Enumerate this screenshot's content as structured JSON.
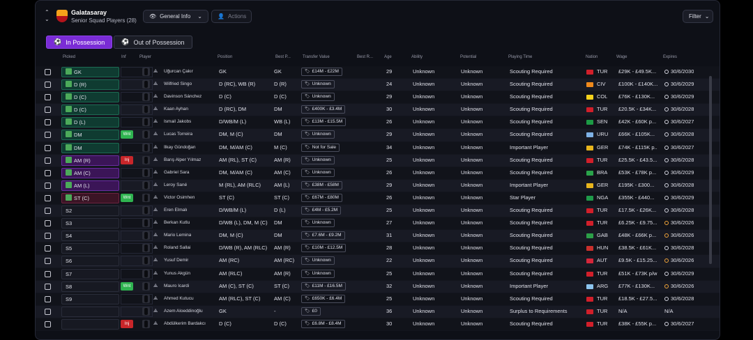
{
  "header": {
    "club_name": "Galatasaray",
    "subtitle": "Senior Squad Players (28)",
    "view_dropdown": "General Info",
    "actions_label": "Actions",
    "filter_label": "Filter"
  },
  "tabs": [
    "In Possession",
    "Out of Possession"
  ],
  "columns": [
    "Picked",
    "Inf",
    "Player",
    "Position",
    "Best P...",
    "Transfer Value",
    "Best R...",
    "Age",
    "Ability",
    "Potential",
    "Playing Time",
    "Nation",
    "Wage",
    "Expires"
  ],
  "colors": {
    "accent": "#7a2cd6",
    "wanted": "#2fb350",
    "injured": "#c8262a",
    "picked_green": "#0f3b31",
    "picked_purple": "#3b1557"
  },
  "rows": [
    {
      "pick": "GK",
      "pk": "g",
      "inf": "",
      "name": "Uğurcan Çakır",
      "position": "GK",
      "best": "GK",
      "value": "£14M - £22M",
      "age": "29",
      "ability": "Unknown",
      "potential": "Unknown",
      "playing": "Scouting Required",
      "nation": "TUR",
      "flag": "#d11f2a",
      "wage": "£29K - £49.5K...",
      "clock": "white",
      "expires": "30/6/2030"
    },
    {
      "pick": "D (R)",
      "pk": "g",
      "inf": "",
      "name": "Wilfried Singo",
      "position": "D (RC), WB (R)",
      "best": "D (R)",
      "value": "Unknown",
      "age": "24",
      "ability": "Unknown",
      "potential": "Unknown",
      "playing": "Scouting Required",
      "nation": "CIV",
      "flag": "#f08a1c",
      "wage": "£100K - £140K...",
      "clock": "white",
      "expires": "30/6/2029"
    },
    {
      "pick": "D (C)",
      "pk": "g",
      "inf": "",
      "name": "Davinson Sánchez",
      "position": "D (C)",
      "best": "D (C)",
      "value": "Unknown",
      "age": "29",
      "ability": "Unknown",
      "potential": "Unknown",
      "playing": "Scouting Required",
      "nation": "COL",
      "flag": "#f5d21c",
      "wage": "£76K - £130K...",
      "clock": "white",
      "expires": "30/6/2029"
    },
    {
      "pick": "D (C)",
      "pk": "g",
      "inf": "",
      "name": "Kaan Ayhan",
      "position": "D (RC), DM",
      "best": "DM",
      "value": "£400K - £3.4M",
      "age": "30",
      "ability": "Unknown",
      "potential": "Unknown",
      "playing": "Scouting Required",
      "nation": "TUR",
      "flag": "#d11f2a",
      "wage": "£20.5K - £34K...",
      "clock": "white",
      "expires": "30/6/2028"
    },
    {
      "pick": "D (L)",
      "pk": "g",
      "inf": "",
      "name": "Ismail Jakobs",
      "position": "D/WB/M (L)",
      "best": "WB (L)",
      "value": "£13M - £15.5M",
      "age": "26",
      "ability": "Unknown",
      "potential": "Unknown",
      "playing": "Scouting Required",
      "nation": "SEN",
      "flag": "#1c9a44",
      "wage": "£42K - £60K p...",
      "clock": "white",
      "expires": "30/6/2027"
    },
    {
      "pick": "DM",
      "pk": "g",
      "inf": "Wnt",
      "name": "Lucas Torreira",
      "position": "DM, M (C)",
      "best": "DM",
      "value": "Unknown",
      "age": "29",
      "ability": "Unknown",
      "potential": "Unknown",
      "playing": "Scouting Required",
      "nation": "URU",
      "flag": "#7fb2e6",
      "wage": "£66K - £105K...",
      "clock": "white",
      "expires": "30/6/2028"
    },
    {
      "pick": "DM",
      "pk": "g",
      "inf": "",
      "name": "İlkay Gündoğan",
      "position": "DM, M/AM (C)",
      "best": "M (C)",
      "value": "Not for Sale",
      "age": "34",
      "ability": "Unknown",
      "potential": "Unknown",
      "playing": "Important Player",
      "nation": "GER",
      "flag": "#e8b51d",
      "wage": "£74K - £115K p...",
      "clock": "white",
      "expires": "30/6/2027"
    },
    {
      "pick": "AM (R)",
      "pk": "p",
      "inf": "Inj",
      "name": "Barış Alper Yılmaz",
      "position": "AM (RL), ST (C)",
      "best": "AM (R)",
      "value": "Unknown",
      "age": "25",
      "ability": "Unknown",
      "potential": "Unknown",
      "playing": "Scouting Required",
      "nation": "TUR",
      "flag": "#d11f2a",
      "wage": "£25.5K - £43.5...",
      "clock": "white",
      "expires": "30/6/2028"
    },
    {
      "pick": "AM (C)",
      "pk": "p",
      "inf": "",
      "name": "Gabriel Sara",
      "position": "DM, M/AM (C)",
      "best": "AM (C)",
      "value": "Unknown",
      "age": "26",
      "ability": "Unknown",
      "potential": "Unknown",
      "playing": "Scouting Required",
      "nation": "BRA",
      "flag": "#2aa34a",
      "wage": "£53K - £78K p...",
      "clock": "white",
      "expires": "30/6/2029"
    },
    {
      "pick": "AM (L)",
      "pk": "p",
      "inf": "",
      "name": "Leroy Sané",
      "position": "M (RL), AM (RLC)",
      "best": "AM (L)",
      "value": "£38M - £58M",
      "age": "29",
      "ability": "Unknown",
      "potential": "Unknown",
      "playing": "Important Player",
      "nation": "GER",
      "flag": "#e8b51d",
      "wage": "£195K - £300...",
      "clock": "white",
      "expires": "30/6/2028"
    },
    {
      "pick": "ST (C)",
      "pk": "r",
      "inf": "Wnt",
      "name": "Victor Osimhen",
      "position": "ST (C)",
      "best": "ST (C)",
      "value": "£67M - £80M",
      "age": "26",
      "ability": "Unknown",
      "potential": "Unknown",
      "playing": "Star Player",
      "nation": "NGA",
      "flag": "#1f9a4a",
      "wage": "£355K - £440...",
      "clock": "white",
      "expires": "30/6/2029"
    },
    {
      "pick": "S2",
      "pk": "",
      "inf": "",
      "name": "Eren Elmalı",
      "position": "D/WB/M (L)",
      "best": "D (L)",
      "value": "£4M - £5.2M",
      "age": "25",
      "ability": "Unknown",
      "potential": "Unknown",
      "playing": "Scouting Required",
      "nation": "TUR",
      "flag": "#d11f2a",
      "wage": "£17.5K - £26K...",
      "clock": "white",
      "expires": "30/6/2028"
    },
    {
      "pick": "S3",
      "pk": "",
      "inf": "",
      "name": "Berkan Kutlu",
      "position": "D/WB (L), DM, M (C)",
      "best": "DM",
      "value": "Unknown",
      "age": "27",
      "ability": "Unknown",
      "potential": "Unknown",
      "playing": "Scouting Required",
      "nation": "TUR",
      "flag": "#d11f2a",
      "wage": "£6.25K - £9.75...",
      "clock": "amber",
      "expires": "30/6/2026"
    },
    {
      "pick": "S4",
      "pk": "",
      "inf": "",
      "name": "Mario Lemina",
      "position": "DM, M (C)",
      "best": "DM",
      "value": "£7.6M - £9.2M",
      "age": "31",
      "ability": "Unknown",
      "potential": "Unknown",
      "playing": "Scouting Required",
      "nation": "GAB",
      "flag": "#2c9f48",
      "wage": "£48K - £66K p...",
      "clock": "amber",
      "expires": "30/6/2026"
    },
    {
      "pick": "S5",
      "pk": "",
      "inf": "",
      "name": "Roland Sallai",
      "position": "D/WB (R), AM (RLC)",
      "best": "AM (R)",
      "value": "£10M - £12.5M",
      "age": "28",
      "ability": "Unknown",
      "potential": "Unknown",
      "playing": "Scouting Required",
      "nation": "HUN",
      "flag": "#c9302c",
      "wage": "£38.5K - £61K...",
      "clock": "white",
      "expires": "30/6/2028"
    },
    {
      "pick": "S6",
      "pk": "",
      "inf": "",
      "name": "Yusuf Demir",
      "position": "AM (RC)",
      "best": "AM (RC)",
      "value": "Unknown",
      "age": "22",
      "ability": "Unknown",
      "potential": "Unknown",
      "playing": "Scouting Required",
      "nation": "AUT",
      "flag": "#d6263a",
      "wage": "£9.5K - £15.25...",
      "clock": "amber",
      "expires": "30/6/2026"
    },
    {
      "pick": "S7",
      "pk": "",
      "inf": "",
      "name": "Yunus Akgün",
      "position": "AM (RLC)",
      "best": "AM (R)",
      "value": "Unknown",
      "age": "25",
      "ability": "Unknown",
      "potential": "Unknown",
      "playing": "Scouting Required",
      "nation": "TUR",
      "flag": "#d11f2a",
      "wage": "£51K - £73K p/w",
      "clock": "white",
      "expires": "30/6/2029"
    },
    {
      "pick": "S8",
      "pk": "",
      "inf": "Wnt",
      "name": "Mauro Icardi",
      "position": "AM (C), ST (C)",
      "best": "ST (C)",
      "value": "£11M - £16.5M",
      "age": "32",
      "ability": "Unknown",
      "potential": "Unknown",
      "playing": "Important Player",
      "nation": "ARG",
      "flag": "#8cc4ee",
      "wage": "£77K - £130K...",
      "clock": "amber",
      "expires": "30/6/2026"
    },
    {
      "pick": "S9",
      "pk": "",
      "inf": "",
      "name": "Ahmed Kutucu",
      "position": "AM (RLC), ST (C)",
      "best": "AM (C)",
      "value": "£650K - £6.4M",
      "age": "25",
      "ability": "Unknown",
      "potential": "Unknown",
      "playing": "Scouting Required",
      "nation": "TUR",
      "flag": "#d11f2a",
      "wage": "£18.5K - £27.5...",
      "clock": "white",
      "expires": "30/6/2028"
    },
    {
      "pick": "",
      "pk": "",
      "inf": "",
      "name": "Azem Aloeddinoğlu",
      "position": "GK",
      "best": "-",
      "value": "£0",
      "age": "36",
      "ability": "Unknown",
      "potential": "Unknown",
      "playing": "Surplus to Requirements",
      "nation": "TUR",
      "flag": "#d11f2a",
      "wage": "N/A",
      "clock": "none",
      "expires": "N/A"
    },
    {
      "pick": "",
      "pk": "",
      "inf": "Inj",
      "name": "Abdülkerim Bardakcı",
      "position": "D (C)",
      "best": "D (C)",
      "value": "£6.8M - £8.4M",
      "age": "30",
      "ability": "Unknown",
      "potential": "Unknown",
      "playing": "Scouting Required",
      "nation": "TUR",
      "flag": "#d11f2a",
      "wage": "£38K - £55K p...",
      "clock": "white",
      "expires": "30/6/2027"
    }
  ]
}
